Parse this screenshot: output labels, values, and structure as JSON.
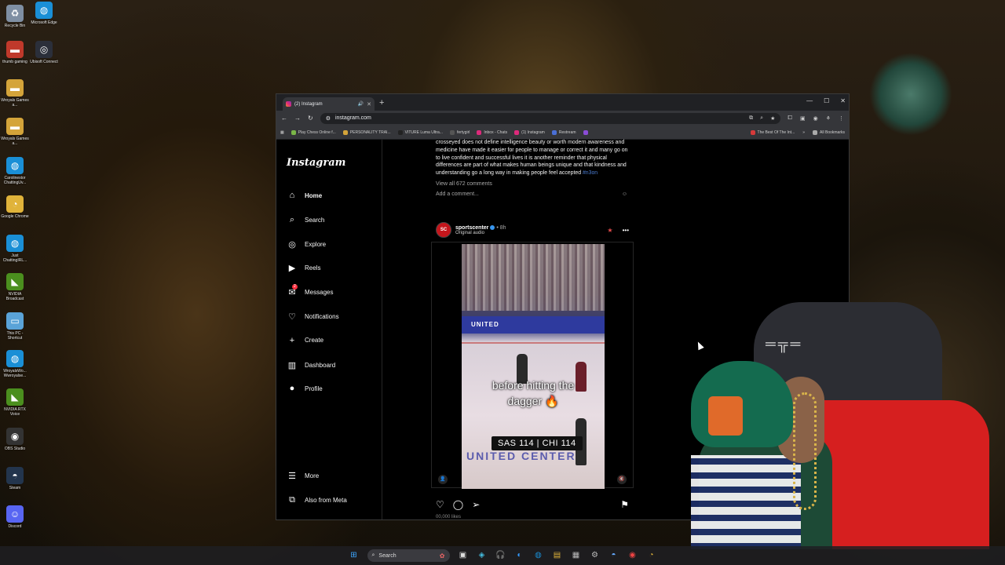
{
  "desktop": {
    "icons": [
      {
        "label": "Recycle Bin",
        "icon": "recycle-bin-icon",
        "color": "#7f8fa3"
      },
      {
        "label": "Microsoft Edge",
        "icon": "edge-icon",
        "color": "#1a8fd6"
      },
      {
        "label": "thumb gaming",
        "icon": "folder-icon",
        "color": "#c0392b"
      },
      {
        "label": "Ubisoft Connect",
        "icon": "ubisoft-icon",
        "color": "#2b2f3a"
      },
      {
        "label": "Wroyals Games a...",
        "icon": "folder-icon",
        "color": "#d4a43a"
      },
      {
        "label": "Wroyals Games a...",
        "icon": "folder-icon",
        "color": "#d4a43a"
      },
      {
        "label": "Carolinestor ChattingUv...",
        "icon": "edge-icon",
        "color": "#1a8fd6"
      },
      {
        "label": "Google Chrome",
        "icon": "chrome-icon",
        "color": "#e0b33a"
      },
      {
        "label": "Just ChattingIRL...",
        "icon": "edge-icon",
        "color": "#1a8fd6"
      },
      {
        "label": "NVIDIA Broadcast",
        "icon": "nvidia-icon",
        "color": "#4b8f1e"
      },
      {
        "label": "This PC - Shortcut",
        "icon": "pc-icon",
        "color": "#5aa3d8"
      },
      {
        "label": "WroyalsWo... Wwroyalse...",
        "icon": "edge-icon",
        "color": "#1a8fd6"
      },
      {
        "label": "NVIDIA RTX Voice",
        "icon": "nvidia-icon",
        "color": "#4b8f1e"
      },
      {
        "label": "OBS Studio",
        "icon": "obs-icon",
        "color": "#333333"
      },
      {
        "label": "Steam",
        "icon": "steam-icon",
        "color": "#23354d"
      },
      {
        "label": "Discord",
        "icon": "discord-icon",
        "color": "#5865f2"
      }
    ]
  },
  "browser": {
    "tab_title": "(2) Instagram",
    "url": "instagram.com",
    "bookmarks": [
      "Play Chess Online f...",
      "PERSONALITY TRAI...",
      "VITURE Luma Ultra...",
      "fertygirl",
      "Inbox - Chats",
      "(1) Instagram",
      "Restream",
      "The Best Of The Int..."
    ],
    "all_bookmarks": "All Bookmarks"
  },
  "instagram": {
    "logo": "Instagram",
    "nav": [
      {
        "label": "Home",
        "icon": "home-icon"
      },
      {
        "label": "Search",
        "icon": "search-icon"
      },
      {
        "label": "Explore",
        "icon": "explore-icon"
      },
      {
        "label": "Reels",
        "icon": "reels-icon"
      },
      {
        "label": "Messages",
        "icon": "messages-icon",
        "badge": "2"
      },
      {
        "label": "Notifications",
        "icon": "heart-icon"
      },
      {
        "label": "Create",
        "icon": "plus-icon"
      },
      {
        "label": "Dashboard",
        "icon": "dashboard-icon"
      },
      {
        "label": "Profile",
        "icon": "avatar-icon"
      }
    ],
    "more": "More",
    "also_from_meta": "Also from Meta",
    "prev_post": {
      "caption": "crosseyed does not define intelligence beauty or worth modern awareness and medicine have made it easier for people to manage or correct it and many go on to live confident and successful lives it is another reminder that physical differences are part of what makes human beings unique and that kindness and understanding go a long way in making people feel accepted",
      "hashtag": "#n3on",
      "view_comments": "View all 672 comments",
      "add_comment": "Add a comment..."
    },
    "post": {
      "username": "sportscenter",
      "time": "8h",
      "audio": "Original audio",
      "avatar_text": "SC",
      "video": {
        "banner": "UNITED",
        "overlay_line1": "before hitting the",
        "overlay_line2": "dagger 🔥",
        "score": "SAS 114 | CHI 114",
        "banner2": "UNITED CENTER"
      },
      "likes_peek": "00,000 likes"
    }
  },
  "taskbar": {
    "search_label": "Search"
  }
}
